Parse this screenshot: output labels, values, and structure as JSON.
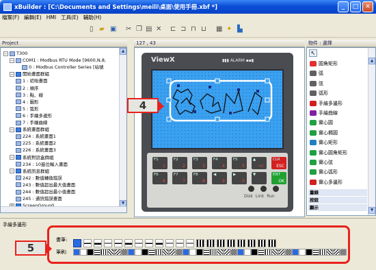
{
  "window": {
    "title": "xBuilder : [C:\\Documents and Settings\\meili\\桌面\\使用手冊.xbf *]",
    "buttons": [
      "_",
      "□",
      "✕"
    ]
  },
  "menu": [
    "檔案(F)",
    "編輯(E)",
    "HMI",
    "工具(E)",
    "輔助(H)"
  ],
  "toolbar": {
    "icons": [
      "page-icon",
      "open-icon",
      "save-icon",
      "cut-icon",
      "copy-icon",
      "paste-icon",
      "delete-icon",
      "align-left-icon",
      "align-right-icon",
      "align-top-icon",
      "align-bottom-icon",
      "grid-icon",
      "compile-icon",
      "transfer-icon"
    ]
  },
  "project_panel": {
    "header": "Project",
    "items": [
      {
        "label": "T300",
        "level": 0,
        "expand": "−",
        "kind": "device"
      },
      {
        "label": "COM1 : Modbus RTU Mode [9600,N,8,",
        "level": 1,
        "expand": "−",
        "kind": "item"
      },
      {
        "label": "0 : Modbus Controller Series [站號",
        "level": 3,
        "expand": "",
        "kind": "item"
      },
      {
        "label": "開始畫面群組",
        "level": 1,
        "expand": "−",
        "kind": "folder"
      },
      {
        "label": "1 : 初始畫面",
        "level": 2,
        "expand": "",
        "kind": "item"
      },
      {
        "label": "2 : 順序",
        "level": 2,
        "expand": "",
        "kind": "item"
      },
      {
        "label": "3 : 點、線",
        "level": 2,
        "expand": "",
        "kind": "item"
      },
      {
        "label": "4 : 圖形",
        "level": 2,
        "expand": "",
        "kind": "item"
      },
      {
        "label": "5 : 弧形",
        "level": 2,
        "expand": "",
        "kind": "item"
      },
      {
        "label": "6 : 手繪多邊形",
        "level": 2,
        "expand": "",
        "kind": "item"
      },
      {
        "label": "7 : 手繪曲線",
        "level": 2,
        "expand": "",
        "kind": "item"
      },
      {
        "label": "系統畫面群組",
        "level": 1,
        "expand": "−",
        "kind": "folder"
      },
      {
        "label": "224 : 系統畫面1",
        "level": 2,
        "expand": "",
        "kind": "item"
      },
      {
        "label": "225 : 系統畫面2",
        "level": 2,
        "expand": "",
        "kind": "item"
      },
      {
        "label": "226 : 系統畫面3",
        "level": 2,
        "expand": "",
        "kind": "item"
      },
      {
        "label": "系統對話盒群組",
        "level": 1,
        "expand": "−",
        "kind": "folder"
      },
      {
        "label": "234 : 10進位輸入畫面",
        "level": 2,
        "expand": "",
        "kind": "item"
      },
      {
        "label": "系統訊息群組",
        "level": 1,
        "expand": "−",
        "kind": "folder"
      },
      {
        "label": "242 : 數值轉換錯誤",
        "level": 2,
        "expand": "",
        "kind": "item"
      },
      {
        "label": "243 : 數值超出最大值畫面",
        "level": 2,
        "expand": "",
        "kind": "item"
      },
      {
        "label": "244 : 數值超出最小值畫面",
        "level": 2,
        "expand": "",
        "kind": "item"
      },
      {
        "label": "245 : 通訊錯誤畫面",
        "level": 2,
        "expand": "",
        "kind": "item"
      },
      {
        "label": "ScreenGroup0",
        "level": 1,
        "expand": "+",
        "kind": "folder"
      }
    ]
  },
  "canvas": {
    "coord": "127 , 43",
    "brand": "ViewX",
    "alarm": "▮▮▮ ALARM ▪▪▮",
    "callout": "4",
    "keys_row1": [
      {
        "top": "F1",
        "bottom": "1"
      },
      {
        "top": "F2",
        "bottom": "2"
      },
      {
        "top": "F3",
        "bottom": "3"
      },
      {
        "top": "F4",
        "bottom": "4"
      },
      {
        "top": "F5",
        "bottom": "5"
      },
      {
        "top": "▲",
        "bottom": "+/-"
      },
      {
        "top": "CLR",
        "bottom": "ESC"
      }
    ],
    "keys_row2": [
      {
        "top": "F6",
        "bottom": "6"
      },
      {
        "top": "F7",
        "bottom": "7"
      },
      {
        "top": "F8",
        "bottom": "8"
      },
      {
        "top": "◀",
        "bottom": "9"
      },
      {
        "top": "▶",
        "bottom": "0"
      },
      {
        "top": "▼",
        "bottom": "."
      },
      {
        "top": "ENT",
        "bottom": "OK"
      }
    ],
    "leds": [
      "Disk",
      "Link",
      "Run"
    ]
  },
  "objects_panel": {
    "header": "物件 : 選擇",
    "items": [
      {
        "label": "圓角矩形",
        "icon": "rounded-rect-icon",
        "color": "#e03030"
      },
      {
        "label": "弧",
        "icon": "arc-icon",
        "color": "#606060"
      },
      {
        "label": "弦",
        "icon": "chord-icon",
        "color": "#606060"
      },
      {
        "label": "弧形",
        "icon": "pie-icon",
        "color": "#606060"
      },
      {
        "label": "手繪多邊形",
        "icon": "freehand-polygon-icon",
        "color": "#d02020"
      },
      {
        "label": "手繪曲線",
        "icon": "freehand-curve-icon",
        "color": "#8020a0"
      },
      {
        "label": "實心圓",
        "icon": "solid-circle-icon",
        "color": "#20a040"
      },
      {
        "label": "實心橢圓",
        "icon": "solid-ellipse-icon",
        "color": "#20a040"
      },
      {
        "label": "實心矩形",
        "icon": "solid-rect-icon",
        "color": "#2080c0"
      },
      {
        "label": "實心圓角矩形",
        "icon": "solid-rounded-rect-icon",
        "color": "#20a040"
      },
      {
        "label": "實心弦",
        "icon": "solid-chord-icon",
        "color": "#20a040"
      },
      {
        "label": "實心弧形",
        "icon": "solid-pie-icon",
        "color": "#20a040"
      },
      {
        "label": "實心多邊形",
        "icon": "solid-polygon-icon",
        "color": "#d02020"
      }
    ],
    "sections": [
      "量錶",
      "按鈕",
      "顯示"
    ]
  },
  "properties": {
    "title": "手繪多邊形",
    "stroke_label": "畫筆:",
    "fill_label": "筆刷:",
    "callout": "5"
  }
}
